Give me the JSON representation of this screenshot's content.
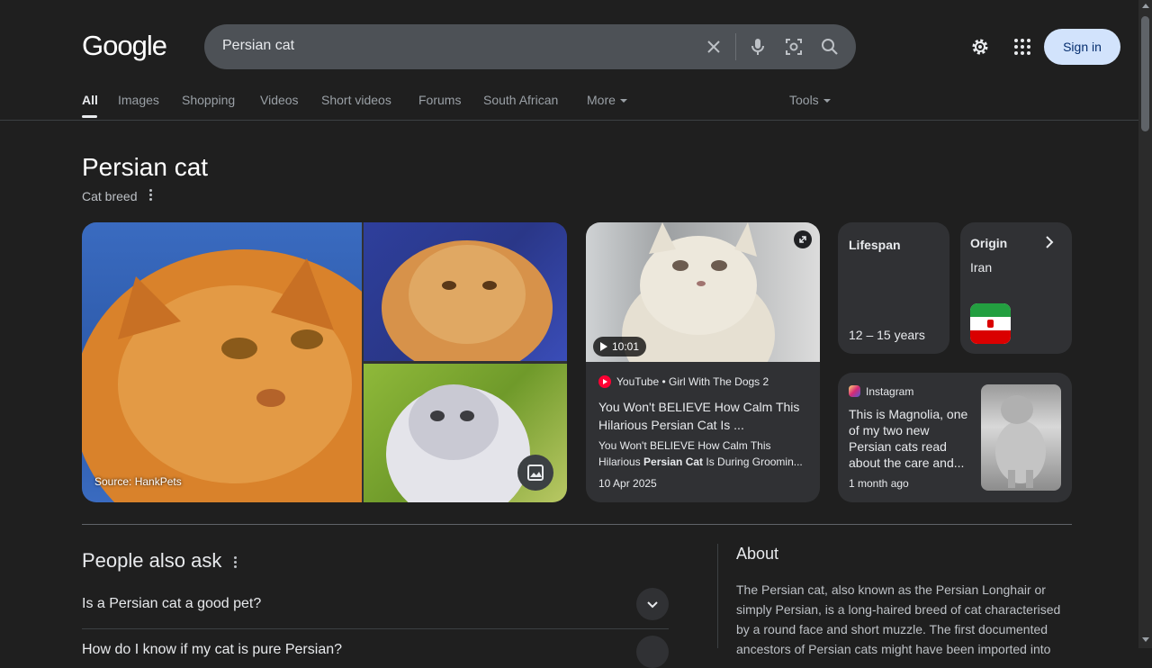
{
  "header": {
    "logo": "Google",
    "search": {
      "query": "Persian cat"
    },
    "signin_label": "Sign in"
  },
  "tabs": [
    {
      "label": "All"
    },
    {
      "label": "Images"
    },
    {
      "label": "Shopping"
    },
    {
      "label": "Videos"
    },
    {
      "label": "Short videos"
    },
    {
      "label": "Forums"
    },
    {
      "label": "South African"
    },
    {
      "label": "More"
    }
  ],
  "tools_label": "Tools",
  "entity": {
    "title": "Persian cat",
    "subtitle": "Cat breed"
  },
  "images": {
    "source": "Source: HankPets"
  },
  "video": {
    "duration": "10:01",
    "source": "YouTube • Girl With The Dogs 2",
    "title": "You Won't BELIEVE How Calm This Hilarious Persian Cat Is ...",
    "desc_pre": "You Won't BELIEVE How Calm This Hilarious ",
    "desc_bold": "Persian Cat",
    "desc_post": " Is During Groomin...",
    "date": "10 Apr 2025"
  },
  "facts": {
    "lifespan": {
      "label": "Lifespan",
      "value": "12 – 15 years"
    },
    "origin": {
      "label": "Origin",
      "value": "Iran"
    }
  },
  "instagram": {
    "source": "Instagram",
    "text": "This is Magnolia, one of my two new Persian cats read about the care and...",
    "date": "1 month ago"
  },
  "people_also_ask": {
    "title": "People also ask",
    "questions": [
      "Is a Persian cat a good pet?",
      "How do I know if my cat is pure Persian?"
    ]
  },
  "about": {
    "title": "About",
    "text": "The Persian cat, also known as the Persian Longhair or simply Persian, is a long-haired breed of cat characterised by a round face and short muzzle. The first documented ancestors of Persian cats might have been imported into"
  },
  "colors": {
    "background": "#1f1f1f",
    "card": "#303134",
    "signin_bg": "#d2e3fc",
    "youtube_red": "#ff0033"
  }
}
